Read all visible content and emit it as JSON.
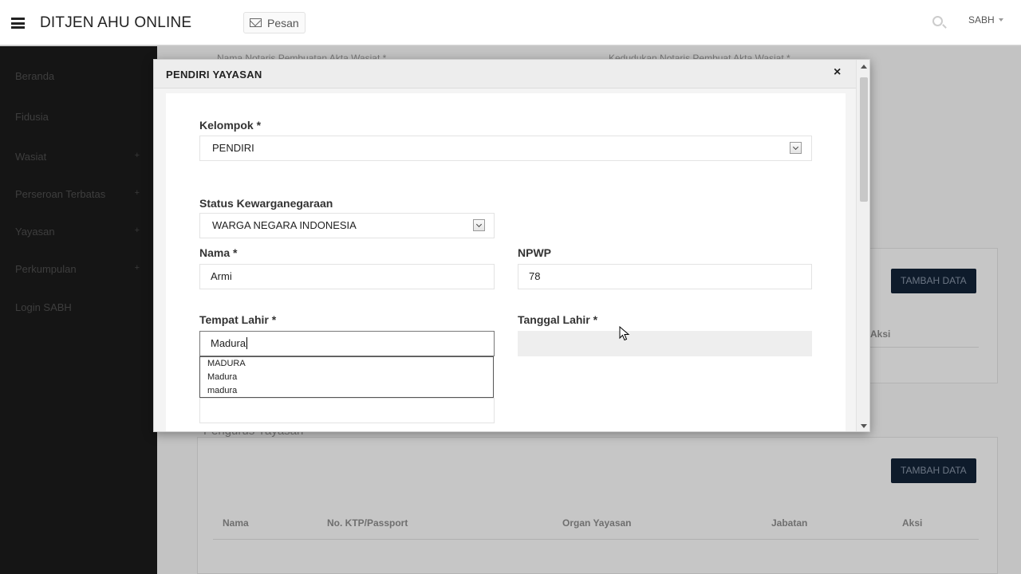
{
  "header": {
    "brand": "DITJEN AHU ONLINE",
    "pesan_label": "Pesan",
    "user_label": "SABH"
  },
  "sidebar": {
    "items": [
      {
        "label": "Beranda",
        "expandable": false
      },
      {
        "label": "Fidusia",
        "expandable": false
      },
      {
        "label": "Wasiat",
        "expandable": true
      },
      {
        "label": "Perseroan Terbatas",
        "expandable": true
      },
      {
        "label": "Yayasan",
        "expandable": true
      },
      {
        "label": "Perkumpulan",
        "expandable": true
      },
      {
        "label": "Login SABH",
        "expandable": false
      }
    ],
    "expand_glyph": "+"
  },
  "background": {
    "notaris_label_1": "Nama Notaris Pembuatan Akta Wasiat *",
    "notaris_label_2": "Kedudukan Notaris Pembuat Akta Wasiat *",
    "tambah_data_1": "TAMBAH DATA",
    "aksi_1": "Aksi",
    "section_pengurus": "Pengurus Yayasan",
    "tambah_data_2": "TAMBAH DATA",
    "pengurus_columns": [
      "Nama",
      "No. KTP/Passport",
      "Organ Yayasan",
      "Jabatan",
      "Aksi"
    ]
  },
  "modal": {
    "title": "PENDIRI YAYASAN",
    "close_glyph": "×",
    "kelompok": {
      "label": "Kelompok *",
      "value": "PENDIRI"
    },
    "status_kewarganegaraan": {
      "label": "Status Kewarganegaraan",
      "value": "WARGA NEGARA INDONESIA"
    },
    "nama": {
      "label": "Nama *",
      "value": "Armi"
    },
    "npwp": {
      "label": "NPWP",
      "value": "78"
    },
    "tempat_lahir": {
      "label": "Tempat Lahir *",
      "value": "Madura"
    },
    "tanggal_lahir": {
      "label": "Tanggal Lahir *",
      "value": ""
    },
    "autocomplete_options": [
      "MADURA",
      "Madura",
      "madura"
    ]
  },
  "icons": {
    "menu": "hamburger-menu-icon",
    "mail": "envelope-icon",
    "search": "search-icon",
    "close": "close-icon",
    "dropdown": "chevron-down-icon",
    "pointer": "mouse-pointer-icon"
  }
}
